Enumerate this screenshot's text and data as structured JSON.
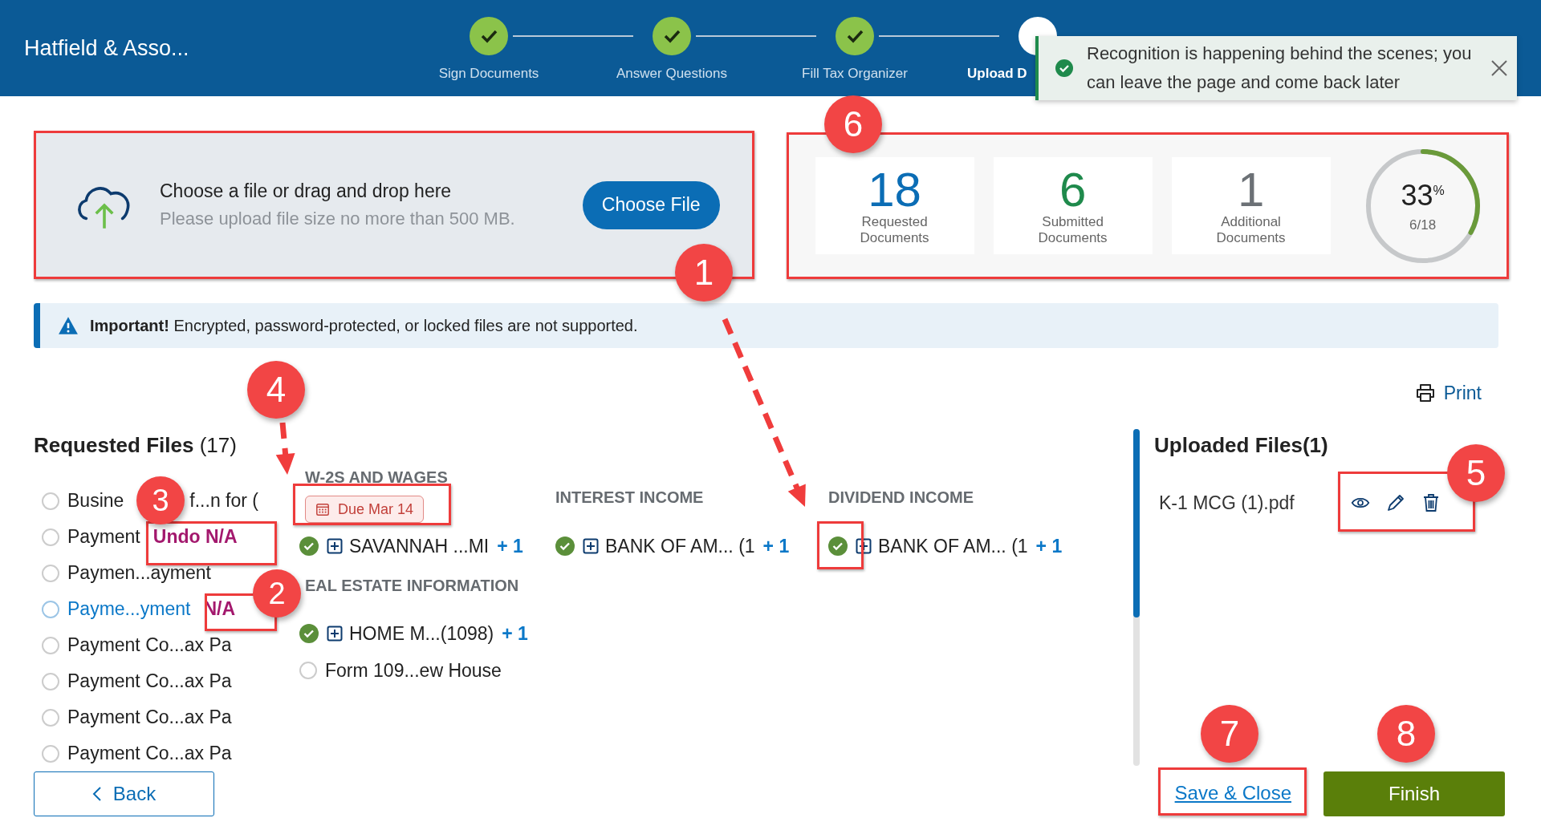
{
  "header": {
    "brand": "Hatfield & Asso...",
    "steps": [
      {
        "label": "Sign Documents",
        "kind": "done"
      },
      {
        "label": "Answer Questions",
        "kind": "done"
      },
      {
        "label": "Fill Tax Organizer",
        "kind": "done"
      },
      {
        "label": "Upload D",
        "kind": "current"
      }
    ]
  },
  "toast": {
    "message": "Recognition is happening behind the scenes; you can leave the page and come back later"
  },
  "upload": {
    "title": "Choose a file or drag and drop here",
    "hint": "Please upload file size no more than 500 MB.",
    "button": "Choose File"
  },
  "stats": {
    "cards": [
      {
        "value": "18",
        "label": "Requested Documents",
        "color": "#0b6db5"
      },
      {
        "value": "6",
        "label": "Submitted Documents",
        "color": "#1f8a4c"
      },
      {
        "value": "1",
        "label": "Additional Documents",
        "color": "#6c7176"
      }
    ],
    "progress": {
      "percent": "33$^{%}$",
      "count": "6/18",
      "level": 0.33
    }
  },
  "notice": {
    "text": "**Important!** Encrypted, password-protected, or locked files are not supported."
  },
  "print": "Print",
  "requested": {
    "title": "Requested Files",
    "count": "(17)",
    "items": [
      {
        "label": "Busine",
        "label_tail": "f...n for (",
        "selected": false,
        "checked": false
      },
      {
        "label": "Payment",
        "selected": false,
        "checked": false,
        "action": "Undo N/A"
      },
      {
        "label": "Paymen...ayment",
        "selected": false,
        "checked": false
      },
      {
        "label": "Payme...yment",
        "selected": true,
        "checked": false,
        "action": "N/A"
      },
      {
        "label": "Payment Co...ax Pa",
        "selected": false,
        "checked": false
      },
      {
        "label": "Payment Co...ax Pa",
        "selected": false,
        "checked": false
      },
      {
        "label": "Payment Co...ax Pa",
        "selected": false,
        "checked": false
      },
      {
        "label": "Payment Co...ax Pa",
        "selected": false,
        "checked": false
      }
    ]
  },
  "columns": [
    {
      "groups": [
        {
          "title": "W-2S AND WAGES",
          "due": "Due Mar 14",
          "files": [
            {
              "name": "SAVANNAH ...MI",
              "kind": "uploaded",
              "extra": "+ 1"
            }
          ]
        },
        {
          "title": "EAL ESTATE INFORMATION",
          "files": [
            {
              "name": "HOME M...(1098)",
              "kind": "uploaded",
              "extra": "+ 1"
            },
            {
              "name": "Form 109...ew House",
              "kind": "pending",
              "checked": false
            }
          ]
        }
      ]
    },
    {
      "groups": [
        {
          "title": "INTEREST INCOME",
          "files": [
            {
              "name": "BANK OF AM... (1",
              "kind": "uploaded",
              "extra": "+ 1"
            }
          ]
        }
      ]
    },
    {
      "groups": [
        {
          "title": "DIVIDEND INCOME",
          "files": [
            {
              "name": "BANK OF AM... (1",
              "kind": "uploaded",
              "extra": "+ 1"
            }
          ]
        }
      ]
    }
  ],
  "uploaded": {
    "title": "Uploaded Files(1)",
    "files": [
      {
        "name": "K-1 MCG (1).pdf"
      }
    ]
  },
  "footer": {
    "back": "Back",
    "save": "Save & Close",
    "finish": "Finish"
  },
  "callouts": [
    {
      "number": "1"
    },
    {
      "number": "2"
    },
    {
      "number": "3"
    },
    {
      "number": "4"
    },
    {
      "number": "5"
    },
    {
      "number": "6"
    },
    {
      "number": "7"
    },
    {
      "number": "8"
    }
  ]
}
